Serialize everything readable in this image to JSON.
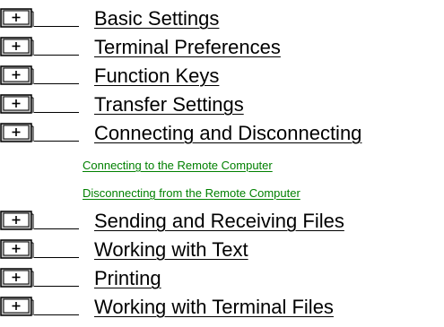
{
  "colors": {
    "topic_text": "#000000",
    "link_text": "#008000",
    "icon_frame": "#000000",
    "icon_fill": "#c0c0c0"
  },
  "icons": {
    "book": "closed-book-plus-icon"
  },
  "topics": [
    {
      "label": "Basic Settings"
    },
    {
      "label": "Terminal Preferences"
    },
    {
      "label": "Function Keys"
    },
    {
      "label": "Transfer Settings"
    },
    {
      "label": "Connecting and Disconnecting"
    },
    {
      "label": "Sending and Receiving Files"
    },
    {
      "label": "Working with Text"
    },
    {
      "label": "Printing"
    },
    {
      "label": "Working with Terminal Files"
    }
  ],
  "subtopics": [
    {
      "label": "Connecting to the Remote Computer"
    },
    {
      "label": "Disconnecting from the Remote Computer"
    }
  ]
}
